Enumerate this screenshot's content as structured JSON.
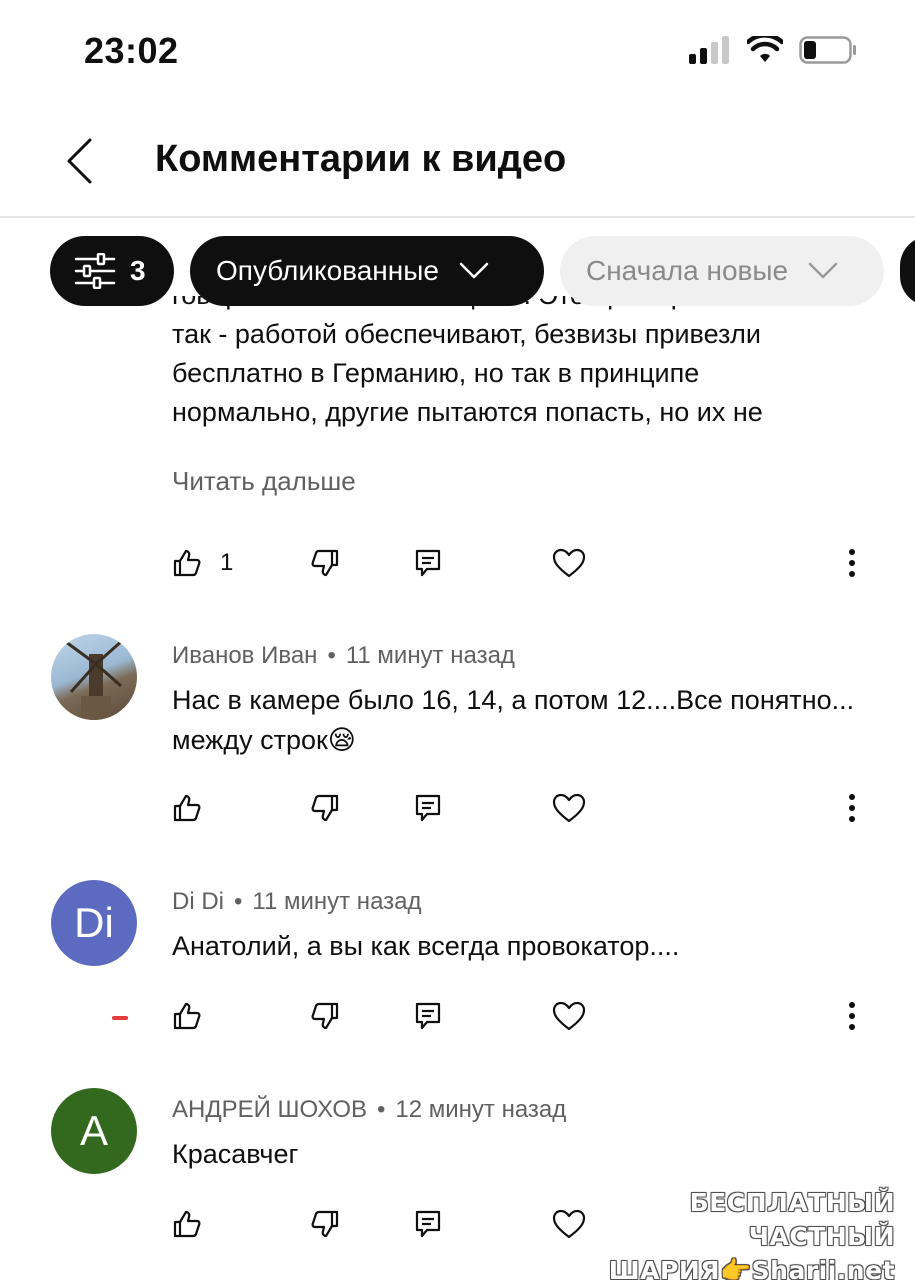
{
  "status_bar": {
    "time": "23:02"
  },
  "header": {
    "title": "Комментарии к видео"
  },
  "chips": {
    "filter_count": "3",
    "published_label": "Опубликованные",
    "sort_label": "Сначала новые"
  },
  "comments": [
    {
      "text_lines": [
        "говорили пленные немцами. Это примерно",
        "так - работой обеспечивают, безвизы привезли",
        "бесплатно в Германию, но так в принципе",
        "нормально, другие пытаются попасть, но их не"
      ],
      "read_more": "Читать дальше",
      "likes": "1"
    },
    {
      "author": "Иванов Иван",
      "time": "11 минут назад",
      "text": "Нас в камере было 16, 14, а потом 12....Все понятно... между строк😪",
      "likes": ""
    },
    {
      "author": "Di Di",
      "time": "11 минут назад",
      "avatar_letters": "Di",
      "avatar_color": "#5c6bc0",
      "text": "Анатолий, а вы как всегда провокатор....",
      "likes": ""
    },
    {
      "author": "АНДРЕЙ ШОХОВ",
      "time": "12 минут назад",
      "avatar_letters": "А",
      "avatar_color": "#33691e",
      "text": "Красавчег",
      "likes": ""
    }
  ],
  "separator": "•",
  "watermark": {
    "line1": "БЕСПЛАТНЫЙ ЧАСТНЫЙ",
    "line2": "ШАРИЯ👉Sharij.net"
  }
}
